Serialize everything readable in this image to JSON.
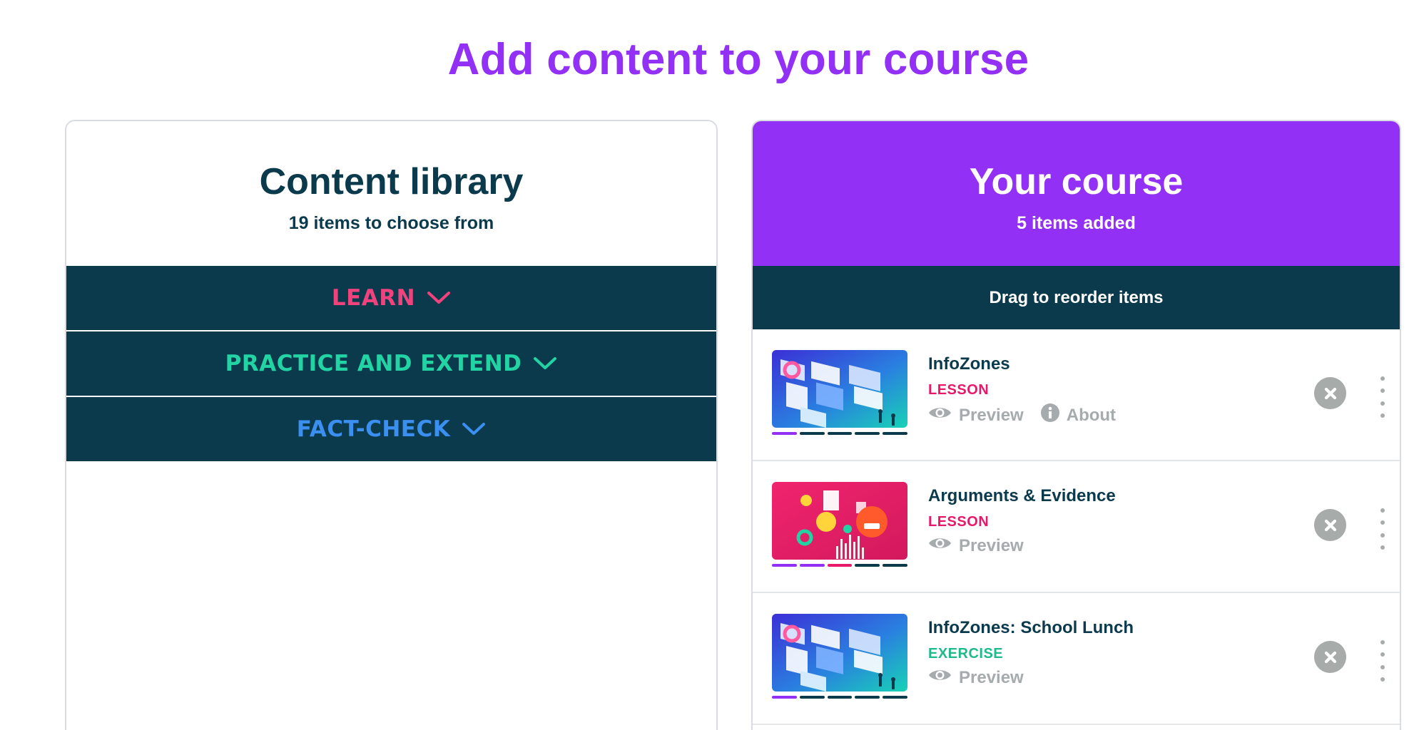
{
  "page": {
    "title": "Add content to your course"
  },
  "library": {
    "title": "Content library",
    "subtitle": "19 items to choose from",
    "categories": [
      {
        "label": "LEARN",
        "color": "#f0437e",
        "icon": "chevron-down-icon"
      },
      {
        "label": "PRACTICE AND EXTEND",
        "color": "#22d4a4",
        "icon": "chevron-down-icon"
      },
      {
        "label": "FACT-CHECK",
        "color": "#3b8ff0",
        "icon": "chevron-down-icon"
      }
    ]
  },
  "course": {
    "title": "Your course",
    "subtitle": "5 items added",
    "drag_hint": "Drag to reorder items",
    "items": [
      {
        "name": "InfoZones",
        "type": "LESSON",
        "type_color": "#e8186a",
        "actions": {
          "preview": "Preview",
          "about": "About"
        },
        "progress": "1 of 5 segments complete"
      },
      {
        "name": "Arguments & Evidence",
        "type": "LESSON",
        "type_color": "#e8186a",
        "actions": {
          "preview": "Preview"
        },
        "progress": "3 of 5 segments complete"
      },
      {
        "name": "InfoZones: School Lunch",
        "type": "EXERCISE",
        "type_color": "#1fb98a",
        "actions": {
          "preview": "Preview"
        },
        "progress": "1 of 5 segments complete"
      }
    ]
  },
  "colors": {
    "brand_purple": "#9230f5",
    "navy": "#0b3a4d",
    "muted_gray": "#a6abae"
  }
}
